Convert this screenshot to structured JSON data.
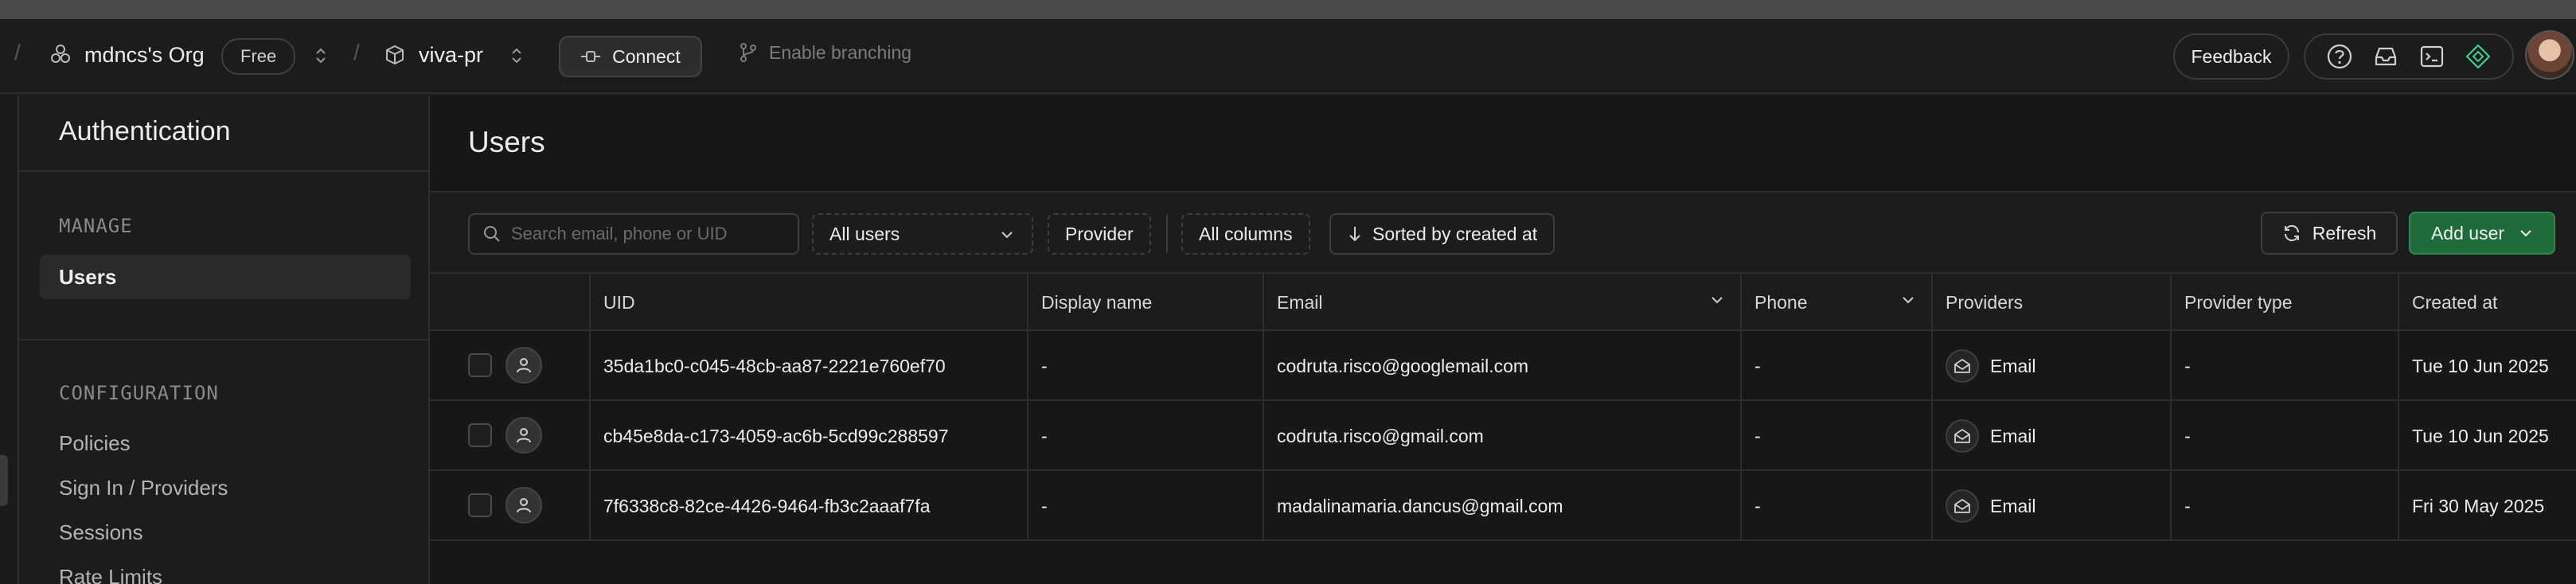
{
  "header": {
    "org_name": "mdncs's Org",
    "plan_badge": "Free",
    "project_name": "viva-pr",
    "connect_label": "Connect",
    "branching_label": "Enable branching",
    "feedback_label": "Feedback",
    "separator": "/"
  },
  "sidebar": {
    "title": "Authentication",
    "manage_section": "MANAGE",
    "active_item": "Users",
    "config_section": "CONFIGURATION",
    "config_items": [
      "Policies",
      "Sign In / Providers",
      "Sessions",
      "Rate Limits"
    ]
  },
  "main": {
    "title": "Users",
    "search_placeholder": "Search email, phone or UID",
    "filter_users": "All users",
    "filter_provider": "Provider",
    "columns_button": "All columns",
    "sort_button": "Sorted by created at",
    "refresh_label": "Refresh",
    "add_user_label": "Add user"
  },
  "table": {
    "columns": [
      "UID",
      "Display name",
      "Email",
      "Phone",
      "Providers",
      "Provider type",
      "Created at"
    ],
    "rows": [
      {
        "uid": "35da1bc0-c045-48cb-aa87-2221e760ef70",
        "display_name": "-",
        "email": "codruta.risco@googlemail.com",
        "phone": "-",
        "provider": "Email",
        "provider_type": "-",
        "created_at": "Tue 10 Jun 2025"
      },
      {
        "uid": "cb45e8da-c173-4059-ac6b-5cd99c288597",
        "display_name": "-",
        "email": "codruta.risco@gmail.com",
        "phone": "-",
        "provider": "Email",
        "provider_type": "-",
        "created_at": "Tue 10 Jun 2025"
      },
      {
        "uid": "7f6338c8-82ce-4426-9464-fb3c2aaaf7fa",
        "display_name": "-",
        "email": "madalinamaria.dancus@gmail.com",
        "phone": "-",
        "provider": "Email",
        "provider_type": "-",
        "created_at": "Fri 30 May 2025"
      }
    ]
  },
  "colors": {
    "background": "#1c1c1c",
    "accent_green": "#1f6b3b",
    "border": "#2e2e2e"
  }
}
